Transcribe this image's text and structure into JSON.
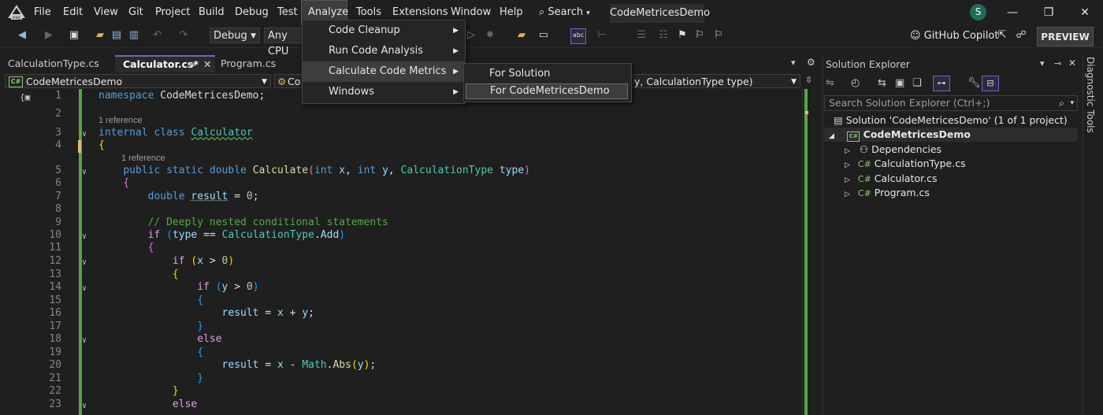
{
  "menu": {
    "items": [
      "File",
      "Edit",
      "View",
      "Git",
      "Project",
      "Build",
      "Debug",
      "Test",
      "Analyze",
      "Tools",
      "Extensions",
      "Window",
      "Help"
    ],
    "search_label": "Search",
    "solution_title": "CodeMetricesDemo",
    "avatar_letter": "S"
  },
  "toolbar": {
    "config": "Debug",
    "platform": "Any CPU",
    "copilot_label": "GitHub Copilot",
    "preview_label": "PREVIEW"
  },
  "tabs": [
    {
      "label": "CalculationType.cs",
      "active": false
    },
    {
      "label": "Calculator.cs*",
      "active": true
    },
    {
      "label": "Program.cs",
      "active": false
    }
  ],
  "nav": {
    "project": "CodeMetricesDemo",
    "type_prefix": "Co",
    "member": "y, CalculationType type)"
  },
  "analyze_menu": {
    "items": [
      "Code Cleanup",
      "Run Code Analysis",
      "Calculate Code Metrics",
      "Windows"
    ],
    "submenu": [
      "For Solution",
      "For CodeMetricesDemo"
    ]
  },
  "editor": {
    "line_numbers": [
      "1",
      "2",
      "3",
      "4",
      "5",
      "6",
      "7",
      "8",
      "9",
      "10",
      "11",
      "12",
      "13",
      "14",
      "15",
      "16",
      "17",
      "18",
      "19",
      "20",
      "21",
      "22",
      "23"
    ],
    "reference_label": "1 reference"
  },
  "solution_explorer": {
    "title": "Solution Explorer",
    "search_placeholder": "Search Solution Explorer (Ctrl+;)",
    "solution": "Solution 'CodeMetricesDemo' (1 of 1 project)",
    "project": "CodeMetricesDemo",
    "items": [
      "Dependencies",
      "CalculationType.cs",
      "Calculator.cs",
      "Program.cs"
    ]
  },
  "diagnostic_tools_label": "Diagnostic Tools",
  "colors": {
    "accent": "#7a5fc0",
    "change_bar": "#57a64a",
    "keyword": "#569cd6",
    "type": "#4ec9b0"
  }
}
